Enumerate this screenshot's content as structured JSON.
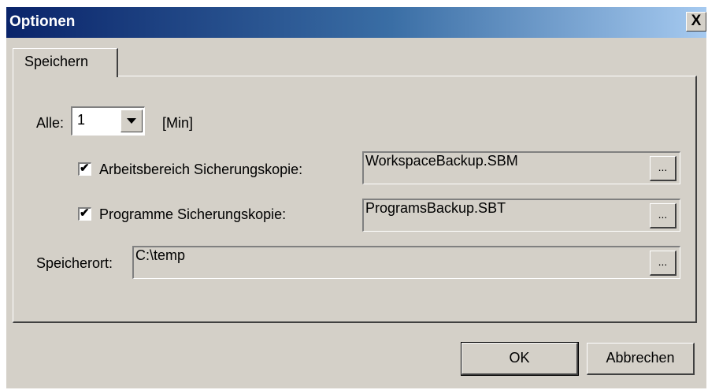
{
  "window": {
    "title": "Optionen",
    "close_glyph": "X"
  },
  "tabs": [
    {
      "label": "Speichern",
      "selected": true
    }
  ],
  "interval": {
    "label": "Alle:",
    "value": "1",
    "unit": "[Min]"
  },
  "workspace_backup": {
    "checked": true,
    "label": "Arbeitsbereich Sicherungskopie:",
    "value": "WorkspaceBackup.SBM",
    "browse_label": "..."
  },
  "programs_backup": {
    "checked": true,
    "label": "Programme Sicherungskopie:",
    "value": "ProgramsBackup.SBT",
    "browse_label": "..."
  },
  "location": {
    "label": "Speicherort:",
    "value": "C:\\temp",
    "browse_label": "..."
  },
  "buttons": {
    "ok": "OK",
    "cancel": "Abbrechen"
  },
  "colors": {
    "titlebar_start": "#0a246a",
    "titlebar_end": "#a6caf0",
    "face": "#d4d0c8"
  },
  "icons": {
    "check": "check-icon",
    "dropdown": "chevron-down-icon",
    "close": "close-icon"
  }
}
